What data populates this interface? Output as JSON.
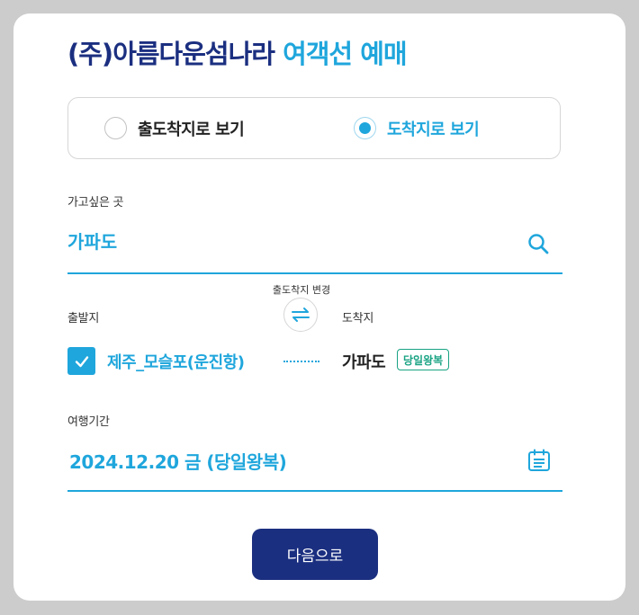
{
  "header": {
    "company": "(주)아름다운섬나라",
    "service": "여객선 예매"
  },
  "view_mode": {
    "options": [
      {
        "label": "출도착지로 보기",
        "selected": false
      },
      {
        "label": "도착지로 보기",
        "selected": true
      }
    ]
  },
  "destination_search": {
    "label": "가고싶은 곳",
    "value": "가파도",
    "icon": "search-icon"
  },
  "route": {
    "swap_label": "출도착지 변경",
    "origin_label": "출발지",
    "destination_label": "도착지",
    "origin_value": "제주_모슬포(운진항)",
    "origin_checked": true,
    "destination_value": "가파도",
    "trip_badge": "당일왕복"
  },
  "travel_period": {
    "label": "여행기간",
    "value": "2024.12.20 금 (당일왕복)",
    "icon": "calendar-icon"
  },
  "actions": {
    "next_label": "다음으로"
  },
  "colors": {
    "primary_navy": "#1b2f80",
    "accent_blue": "#1fa6dc",
    "badge_green": "#19a383",
    "background": "#cccccc"
  }
}
